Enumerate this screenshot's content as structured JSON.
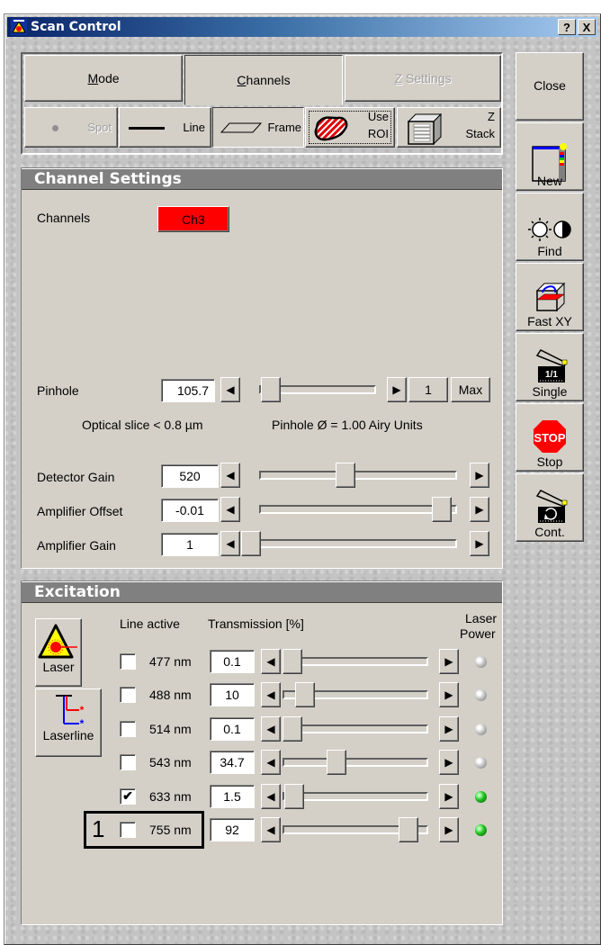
{
  "window": {
    "title": "Scan Control",
    "help_btn": "?",
    "close_btn": "X"
  },
  "tabs": [
    {
      "label": "Mode",
      "accel": "M",
      "rest": "ode",
      "state": "normal"
    },
    {
      "label": "Channels",
      "accel": "C",
      "rest": "hannels",
      "state": "active"
    },
    {
      "label": "Z Settings",
      "accel": "Z",
      "rest": " Settings",
      "state": "disabled"
    }
  ],
  "scan_modes": [
    {
      "label": "Spot",
      "icon": "spot-icon",
      "state": "disabled"
    },
    {
      "label": "Line",
      "icon": "line-icon",
      "state": "normal"
    },
    {
      "label": "Frame",
      "icon": "frame-icon",
      "state": "pressed"
    },
    {
      "label1": "Use",
      "label2": "ROI",
      "icon": "roi-icon",
      "state": "focused"
    },
    {
      "label1": "Z",
      "label2": "Stack",
      "icon": "z-stack-icon",
      "state": "normal"
    }
  ],
  "side_buttons": [
    {
      "label": "Close",
      "icon": ""
    },
    {
      "label": "New",
      "icon": "new-image-icon"
    },
    {
      "label": "Find",
      "icon": "find-brightness-icon"
    },
    {
      "label": "Fast XY",
      "icon": "fast-xy-icon"
    },
    {
      "label": "Single",
      "icon": "single-scan-icon"
    },
    {
      "label": "Stop",
      "icon": "stop-icon"
    },
    {
      "label": "Cont.",
      "icon": "continuous-scan-icon"
    }
  ],
  "channel_settings": {
    "header": "Channel Settings",
    "channels_label": "Channels",
    "channel_button": "Ch3",
    "channel_color": "#ff0000",
    "pinhole": {
      "label": "Pinhole",
      "value": "105.7",
      "slider_fraction": 0.02,
      "airy_value": "1",
      "max_label": "Max"
    },
    "optical_slice": "Optical slice < 0.8 µm",
    "pinhole_airy": "Pinhole Ø = 1.00 Airy Units",
    "detector_gain": {
      "label": "Detector Gain",
      "value": "520",
      "slider_fraction": 0.43
    },
    "amplifier_offset": {
      "label": "Amplifier Offset",
      "value": "-0.01",
      "slider_fraction": 0.97
    },
    "amplifier_gain": {
      "label": "Amplifier Gain",
      "value": "1",
      "slider_fraction": 0.0
    }
  },
  "excitation": {
    "header": "Excitation",
    "laser_button": "Laser",
    "laserline_button": "Laserline",
    "col_line_active": "Line active",
    "col_transmission": "Transmission [%]",
    "col_laser_power_1": "Laser",
    "col_laser_power_2": "Power",
    "lines": [
      {
        "wavelength": "477 nm",
        "checked": false,
        "transmission": "0.1",
        "fraction": 0.0,
        "power_on": false
      },
      {
        "wavelength": "488 nm",
        "checked": false,
        "transmission": "10",
        "fraction": 0.1,
        "power_on": false
      },
      {
        "wavelength": "514 nm",
        "checked": false,
        "transmission": "0.1",
        "fraction": 0.0,
        "power_on": false
      },
      {
        "wavelength": "543 nm",
        "checked": false,
        "transmission": "34.7",
        "fraction": 0.347,
        "power_on": false
      },
      {
        "wavelength": "633 nm",
        "checked": true,
        "transmission": "1.5",
        "fraction": 0.015,
        "power_on": true
      },
      {
        "wavelength": "755 nm",
        "checked": false,
        "transmission": "92",
        "fraction": 0.92,
        "power_on": true
      }
    ],
    "annotation_label": "1"
  }
}
